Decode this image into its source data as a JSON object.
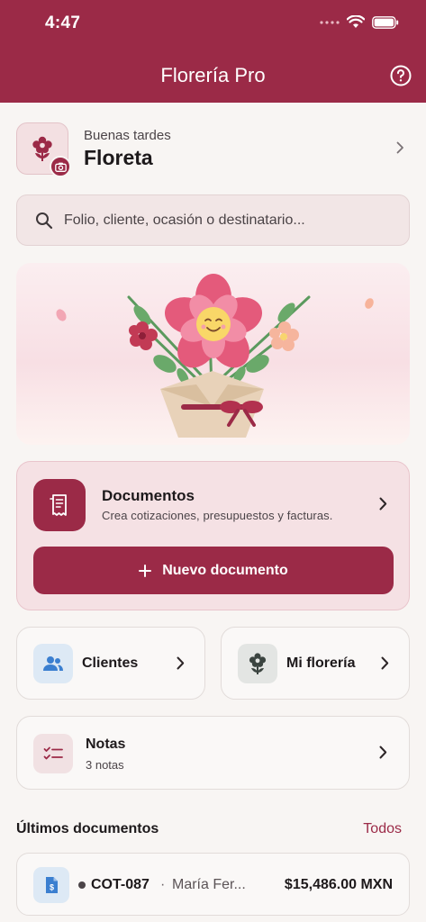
{
  "status_bar": {
    "time": "4:47"
  },
  "header": {
    "title": "Florería Pro",
    "help_icon": "question-circle-icon"
  },
  "greeting": {
    "subtitle": "Buenas tardes",
    "name": "Floreta"
  },
  "search": {
    "placeholder": "Folio, cliente, ocasión o destinatario..."
  },
  "documents_card": {
    "title": "Documentos",
    "subtitle": "Crea cotizaciones, presupuestos y facturas.",
    "new_button": "Nuevo documento"
  },
  "tiles": {
    "clients": {
      "label": "Clientes"
    },
    "shop": {
      "label": "Mi florería"
    }
  },
  "notes": {
    "title": "Notas",
    "count": "3 notas"
  },
  "recent": {
    "title": "Últimos documentos",
    "all_link": "Todos",
    "items": [
      {
        "folio": "COT-087",
        "separator": "·",
        "client": "María Fer...",
        "amount": "$15,486.00 MXN"
      }
    ]
  },
  "colors": {
    "brand": "#9b2a47",
    "background": "#f8f5f3"
  }
}
